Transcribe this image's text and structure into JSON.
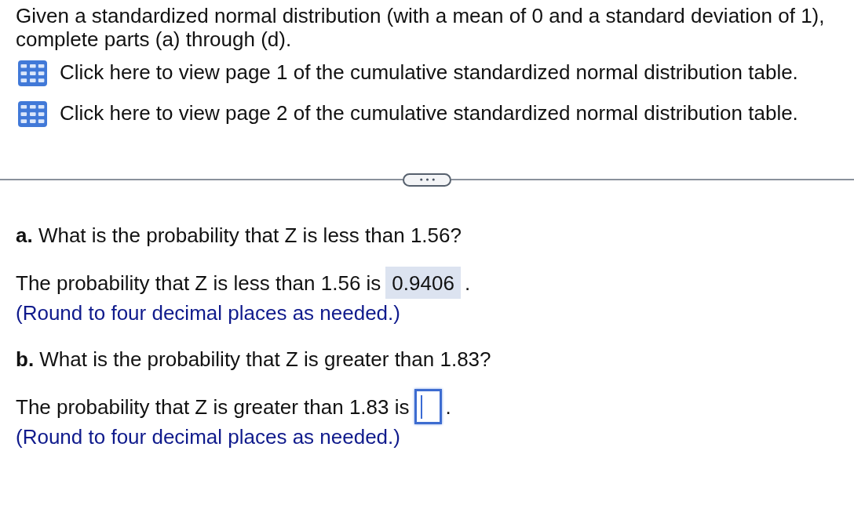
{
  "intro": "Given a standardized normal distribution (with a mean of 0 and a standard deviation of 1), complete parts (a) through (d).",
  "links": [
    "Click here to view page 1 of the cumulative standardized normal distribution table.",
    "Click here to view page 2 of the cumulative standardized normal distribution table."
  ],
  "parts": [
    {
      "question": "**a.** What is the probability that Z is less than 1.56?",
      "answer_prefix": "The probability that Z is less than 1.56 is",
      "answer": {
        "value": "0.9406",
        "focused": false
      },
      "answer_suffix": ".",
      "note": "(Round to four decimal places as needed.)"
    },
    {
      "question": "**b.** What is the probability that Z is greater than 1.83?",
      "answer_prefix": "The probability that Z is greater than 1.83 is",
      "answer": {
        "focused": true
      },
      "answer_suffix": ".",
      "note": "(Round to four decimal places as needed.)"
    }
  ]
}
